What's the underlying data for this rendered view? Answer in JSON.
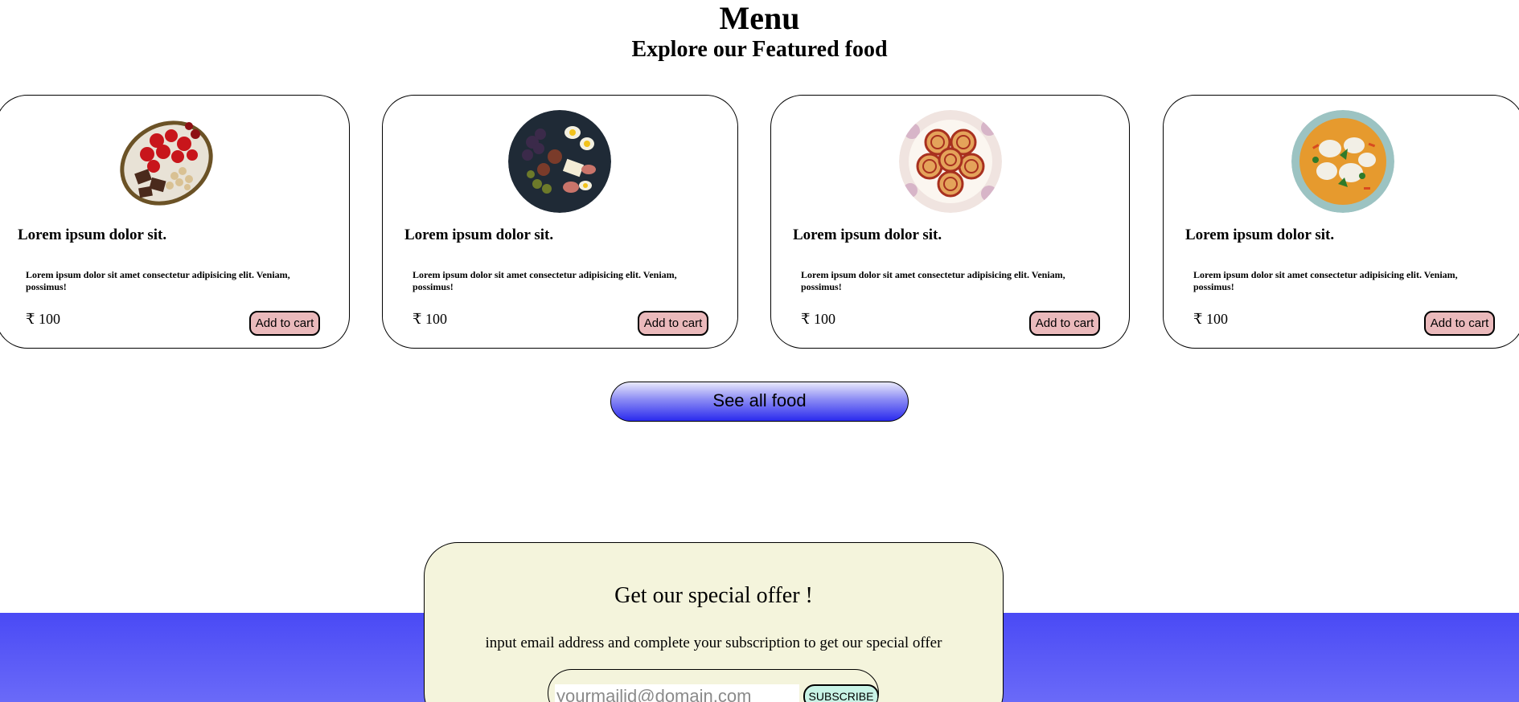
{
  "header": {
    "title": "Menu",
    "subtitle": "Explore our Featured food"
  },
  "cards": [
    {
      "image": "strawberries-cherries-chocolate-plate",
      "title": "Lorem ipsum dolor sit.",
      "description": "Lorem ipsum dolor sit amet consectetur adipisicing elit. Veniam, possimus!",
      "price": "₹ 100",
      "button_label": "Add to cart"
    },
    {
      "image": "grazing-platter-figs-eggs-grapes",
      "title": "Lorem ipsum dolor sit.",
      "description": "Lorem ipsum dolor sit amet consectetur adipisicing elit. Veniam, possimus!",
      "price": "₹ 100",
      "button_label": "Add to cart"
    },
    {
      "image": "jam-swiss-roll-slices",
      "title": "Lorem ipsum dolor sit.",
      "description": "Lorem ipsum dolor sit amet consectetur adipisicing elit. Veniam, possimus!",
      "price": "₹ 100",
      "button_label": "Add to cart"
    },
    {
      "image": "dumpling-curry-soup-bowl",
      "title": "Lorem ipsum dolor sit.",
      "description": "Lorem ipsum dolor sit amet consectetur adipisicing elit. Veniam, possimus!",
      "price": "₹ 100",
      "button_label": "Add to cart"
    }
  ],
  "see_all": {
    "label": "See all food"
  },
  "offer": {
    "title": "Get our special offer !",
    "text": "input email address and complete your subscription to get our special offer",
    "email_placeholder": "yourmailid@domain.com",
    "subscribe_label": "SUBSCRIBE"
  },
  "colors": {
    "add_to_cart_bg": "#eab9bb",
    "see_all_gradient_top": "#e9e9fb",
    "see_all_gradient_bottom": "#2a2aee",
    "footer_band": "#4a4af5",
    "offer_bg": "#f4f4dc",
    "subscribe_bg": "#c8f3e6"
  }
}
